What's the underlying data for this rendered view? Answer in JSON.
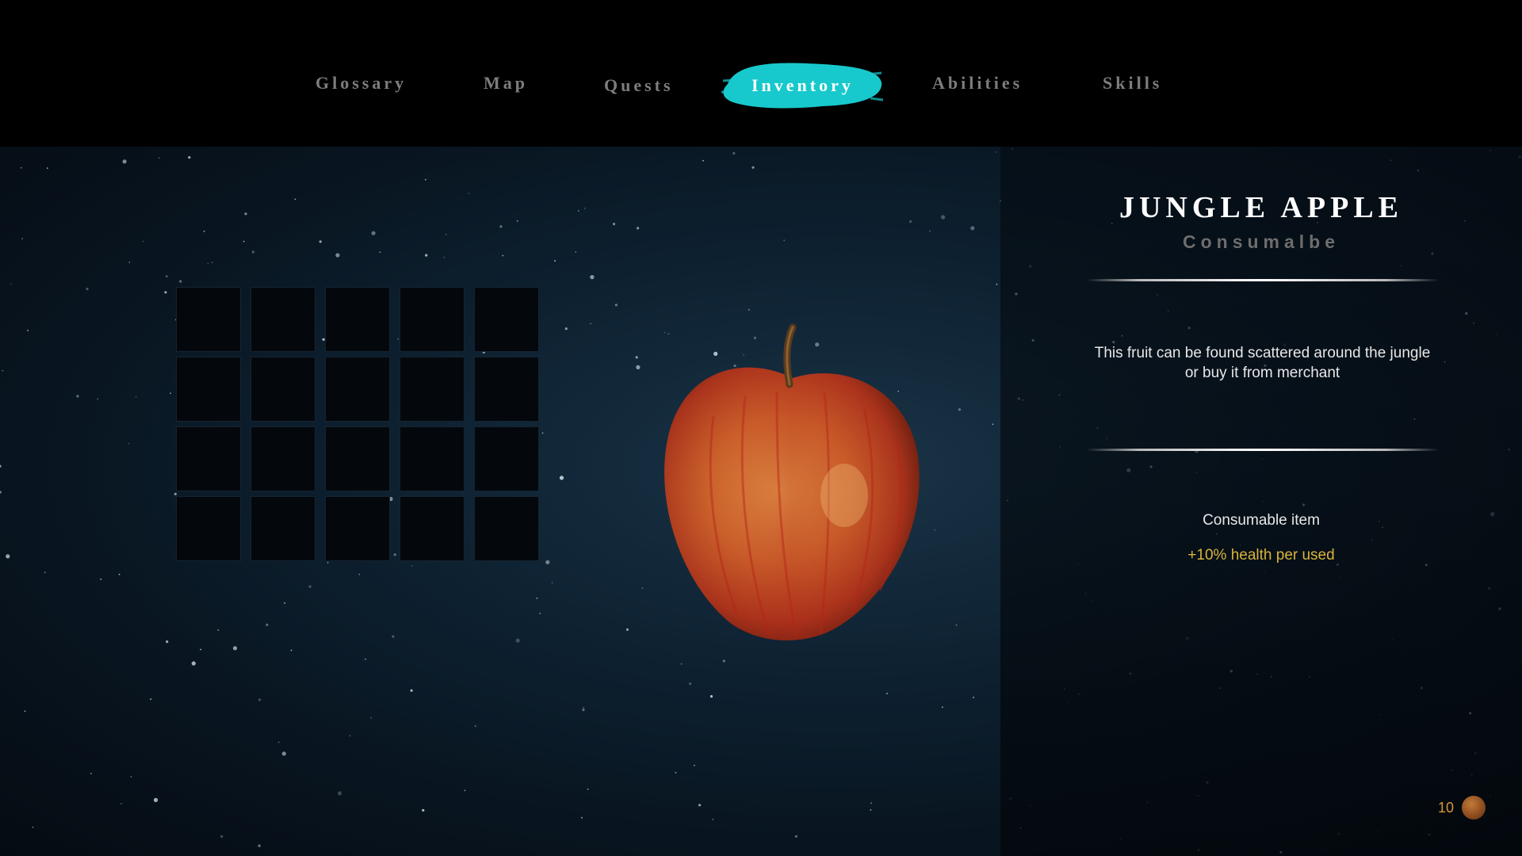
{
  "nav": {
    "items": [
      {
        "label": "Glossary"
      },
      {
        "label": "Map"
      },
      {
        "label": "Quests"
      },
      {
        "label": "Inventory"
      },
      {
        "label": "Abilities"
      },
      {
        "label": "Skills"
      }
    ],
    "active": "Inventory",
    "accent_color": "#1fd3d3"
  },
  "inventory": {
    "rows": 4,
    "columns": 5,
    "selected_item_icon": "apple-icon"
  },
  "item": {
    "title": "JUNGLE APPLE",
    "type": "Consumalbe",
    "description_line1": "This fruit can be found scattered around the jungle",
    "description_line2": "or buy it from merchant",
    "kind": "Consumable item",
    "effect": "+10%  health per used",
    "effect_color": "#d9b43a"
  },
  "currency": {
    "count": "10",
    "icon": "coin-icon"
  }
}
